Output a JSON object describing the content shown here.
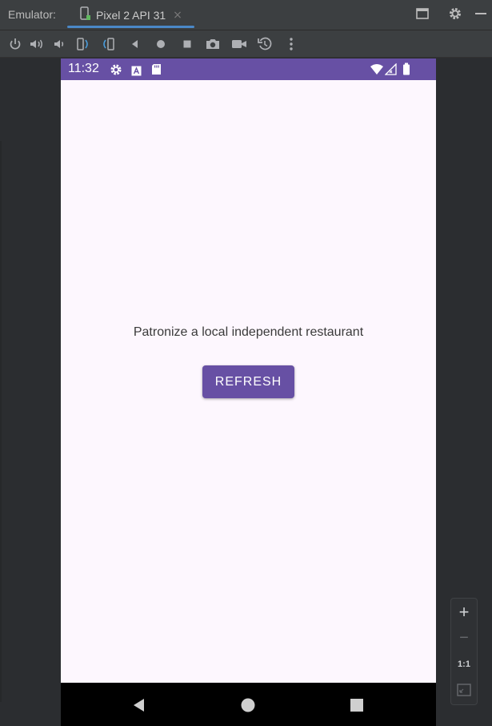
{
  "window": {
    "label": "Emulator:",
    "tab_name": "Pixel 2 API 31",
    "tab_close": "×"
  },
  "toolbar": {
    "tools": [
      "power-icon",
      "volume-up-icon",
      "volume-down-icon",
      "rotate-left-icon",
      "rotate-right-icon",
      "back-icon",
      "home-icon",
      "overview-icon",
      "screenshot-icon",
      "screen-record-icon",
      "snapshot-icon",
      "more-icon"
    ]
  },
  "device": {
    "status_time": "11:32",
    "message": "Patronize a local independent restaurant",
    "refresh_label": "REFRESH",
    "accent": "#6750a4",
    "background": "#fdf7fe"
  },
  "zoom": {
    "zoom_in": "+",
    "zoom_out": "−",
    "actual_size": "1:1"
  }
}
